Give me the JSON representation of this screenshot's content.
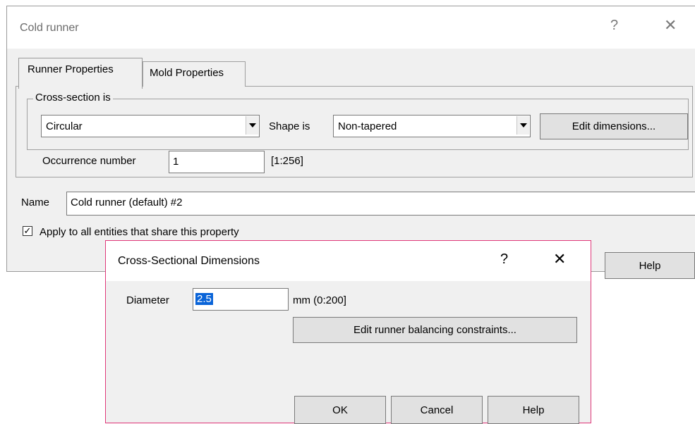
{
  "main_dialog": {
    "title": "Cold runner",
    "help_glyph": "?",
    "close_glyph": "✕",
    "tabs": [
      {
        "label": "Runner Properties",
        "active": true
      },
      {
        "label": "Mold Properties",
        "active": false
      }
    ],
    "cross_section_group": "Cross-section is",
    "cross_section_value": "Circular",
    "shape_label": "Shape is",
    "shape_value": "Non-tapered",
    "edit_dimensions_label": "Edit dimensions...",
    "occurrence_label": "Occurrence number",
    "occurrence_value": "1",
    "occurrence_range": "[1:256]",
    "name_label": "Name",
    "name_value": "Cold runner (default) #2",
    "apply_checked": true,
    "check_glyph": "✓",
    "apply_label": "Apply to all entities that share this property",
    "help_button": "Help"
  },
  "modal_dialog": {
    "title": "Cross-Sectional Dimensions",
    "help_glyph": "?",
    "close_glyph": "✕",
    "diameter_label": "Diameter",
    "diameter_value": "2.5",
    "diameter_unit": "mm (0:200]",
    "balance_button": "Edit runner balancing constraints...",
    "ok_button": "OK",
    "cancel_button": "Cancel",
    "help_button": "Help"
  },
  "colors": {
    "modal_border": "#e0387a",
    "selection": "#0a64d8"
  }
}
